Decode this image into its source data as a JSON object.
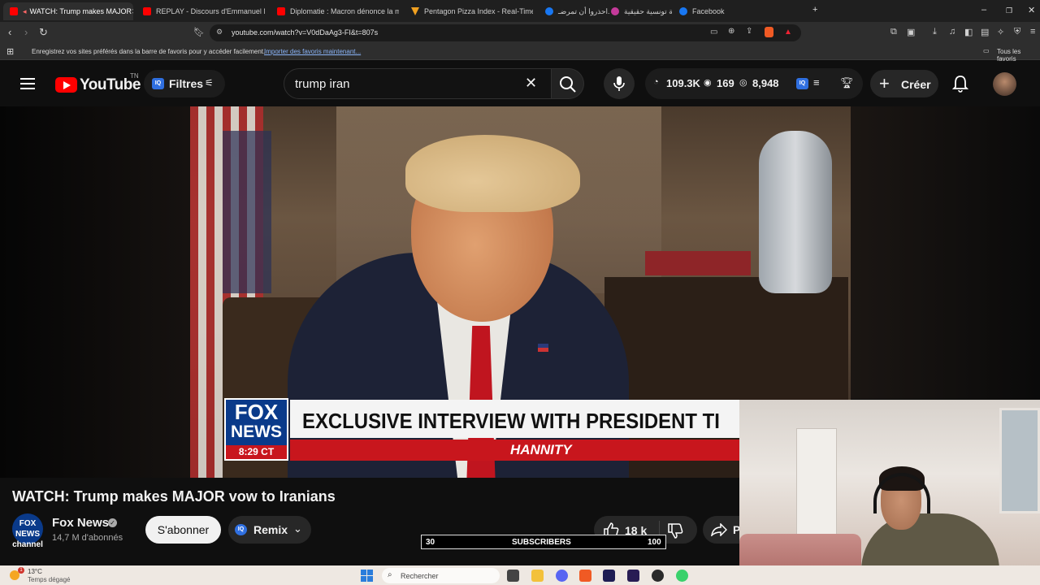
{
  "browser": {
    "tabs": [
      {
        "label": "WATCH: Trump makes MAJOR",
        "active": true
      },
      {
        "label": "REPLAY - Discours d'Emmanuel Macr",
        "active": false
      },
      {
        "label": "Diplomatie : Macron dénonce la mét",
        "active": false
      },
      {
        "label": "Pentagon Pizza Index - Real-Time Mi",
        "active": false
      },
      {
        "label": "احذروا أن تمرضـ...",
        "active": false
      },
      {
        "label": "قصة تونسية حقيقية",
        "active": false
      },
      {
        "label": "Facebook",
        "active": false
      }
    ],
    "url": "youtube.com/watch?v=V0dDaAg3-FI&t=807s",
    "bookmarks_prompt": "Enregistrez vos sites préférés dans la barre de favoris pour y accéder facilement.",
    "bookmarks_link": "Importer des favoris maintenant...",
    "all_bookmarks": "Tous les favoris"
  },
  "youtube": {
    "logo_text": "YouTube",
    "region": "TN",
    "filters_label": "Filtres",
    "search_value": "trump iran",
    "stats": {
      "views": "109.3K",
      "viewers": "169",
      "other": "8,948"
    },
    "create_label": "Créer"
  },
  "video": {
    "lower_third_headline": "EXCLUSIVE INTERVIEW WITH PRESIDENT TI",
    "lower_third_show": "HANNITY",
    "logo_line1": "FOX",
    "logo_line2": "NEWS",
    "logo_time": "8:29 CT"
  },
  "watch": {
    "title": "WATCH: Trump makes MAJOR vow to Iranians",
    "channel_name": "Fox News",
    "channel_avatar_text": "FOX NEWS channel",
    "subscribers": "14,7 M d'abonnés",
    "subscribe_label": "S'abonner",
    "remix_label": "Remix",
    "likes": "18 k",
    "share_label": "P",
    "sub_widget": {
      "start": "30",
      "label": "SUBSCRIBERS",
      "end": "100"
    }
  },
  "taskbar": {
    "weather_temp": "13°C",
    "weather_desc": "Temps dégagé",
    "search_placeholder": "Rechercher",
    "notification_count": "1"
  },
  "colors": {
    "yt_red": "#ff0000",
    "fox_blue": "#0a3a8a",
    "fox_red": "#c8161d",
    "iq_blue": "#2f6fe0"
  }
}
